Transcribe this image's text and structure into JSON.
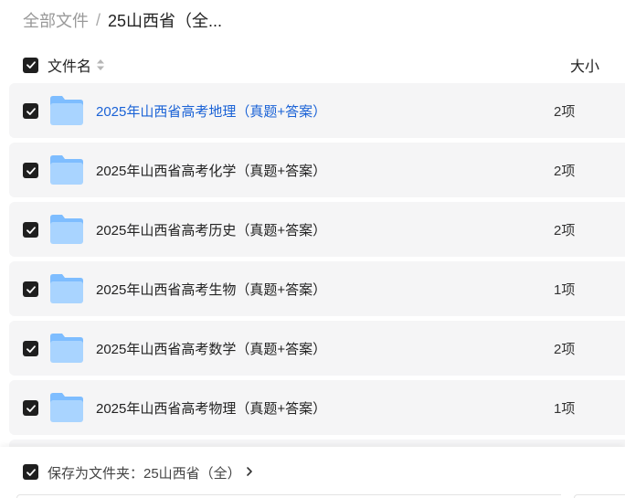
{
  "breadcrumb": {
    "root": "全部文件",
    "separator": "/",
    "current": "25山西省（全..."
  },
  "header": {
    "name_label": "文件名",
    "size_label": "大小",
    "sort_icon": "sort-updown-icon"
  },
  "files": [
    {
      "name": "2025年山西省高考地理（真题+答案）",
      "size": "2项",
      "icon": "folder-icon",
      "highlighted": true
    },
    {
      "name": "2025年山西省高考化学（真题+答案）",
      "size": "2项",
      "icon": "folder-icon",
      "highlighted": false
    },
    {
      "name": "2025年山西省高考历史（真题+答案）",
      "size": "2项",
      "icon": "folder-icon",
      "highlighted": false
    },
    {
      "name": "2025年山西省高考生物（真题+答案）",
      "size": "1项",
      "icon": "folder-icon",
      "highlighted": false
    },
    {
      "name": "2025年山西省高考数学（真题+答案）",
      "size": "2项",
      "icon": "folder-icon",
      "highlighted": false
    },
    {
      "name": "2025年山西省高考物理（真题+答案）",
      "size": "1项",
      "icon": "folder-icon",
      "highlighted": false
    }
  ],
  "footer": {
    "save_label": "保存为文件夹：25山西省（全）",
    "chevron": "chevron-right-icon"
  },
  "colors": {
    "checkbox": "#1f1f1f",
    "row_bg": "#f5f5f6",
    "link_blue": "#1a62d6",
    "folder_light": "#a9d4ff",
    "folder_dark": "#7ebdff"
  }
}
